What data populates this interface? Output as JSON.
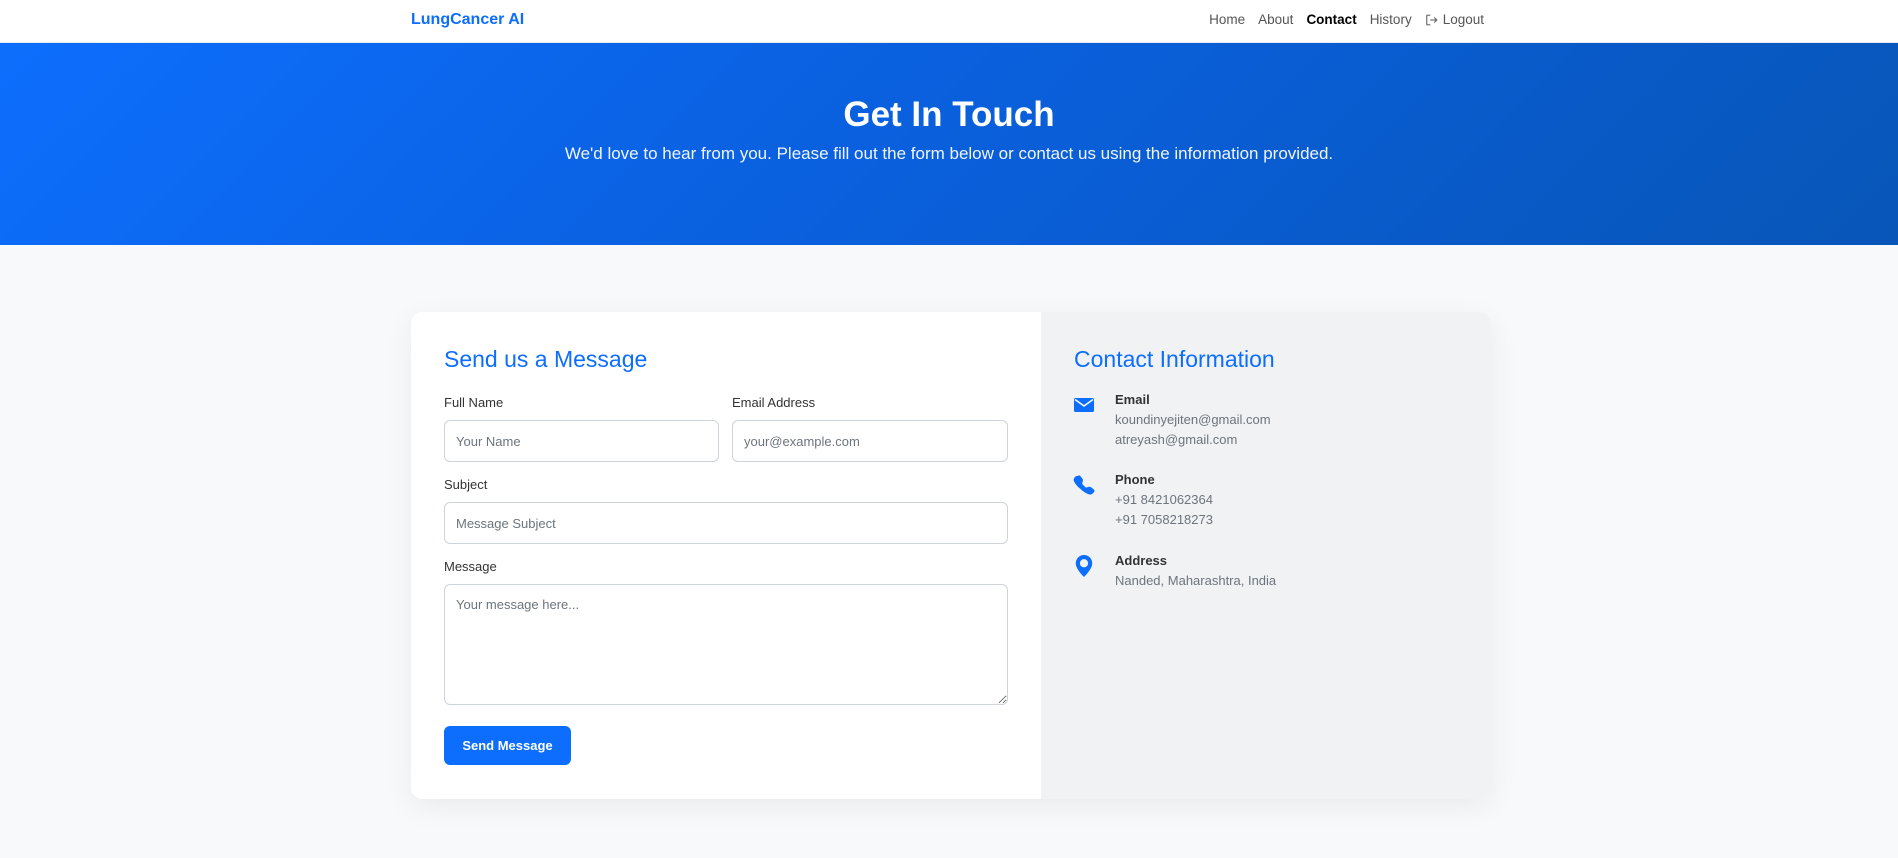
{
  "nav": {
    "brand": "LungCancer AI",
    "links": [
      {
        "label": "Home"
      },
      {
        "label": "About"
      },
      {
        "label": "Contact"
      },
      {
        "label": "History"
      }
    ],
    "logout_label": "Logout",
    "logout_icon": "logout-icon"
  },
  "hero": {
    "title": "Get In Touch",
    "subtitle": "We'd love to hear from you. Please fill out the form below or contact us using the information provided."
  },
  "form": {
    "title": "Send us a Message",
    "full_name_label": "Full Name",
    "full_name_placeholder": "Your Name",
    "email_label": "Email Address",
    "email_placeholder": "your@example.com",
    "subject_label": "Subject",
    "subject_placeholder": "Message Subject",
    "message_label": "Message",
    "message_placeholder": "Your message here...",
    "submit_label": "Send Message"
  },
  "contact": {
    "title": "Contact Information",
    "email": {
      "label": "Email",
      "lines": [
        "koundinyejiten@gmail.com",
        "atreyash@gmail.com"
      ],
      "icon": "envelope-icon"
    },
    "phone": {
      "label": "Phone",
      "lines": [
        "+91 8421062364",
        "+91 7058218273"
      ],
      "icon": "phone-icon"
    },
    "address": {
      "label": "Address",
      "lines": [
        "Nanded, Maharashtra, India"
      ],
      "icon": "map-pin-icon"
    }
  },
  "colors": {
    "primary": "#0d6efd",
    "info_panel_bg": "#f1f2f4",
    "page_bg": "#f8f9fb"
  }
}
